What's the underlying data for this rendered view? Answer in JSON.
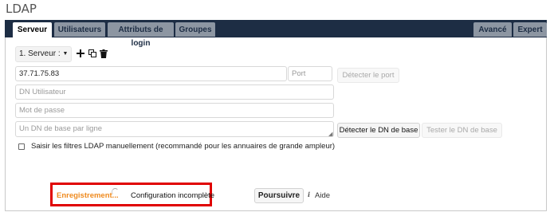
{
  "page": {
    "title": "LDAP"
  },
  "tabs": {
    "serveur": "Serveur",
    "utilisateurs": "Utilisateurs",
    "attributs": "Attributs de login",
    "groupes": "Groupes",
    "avance": "Avancé",
    "expert": "Expert"
  },
  "server": {
    "select_label": "1. Serveur :",
    "host_value": "37.71.75.83",
    "port_placeholder": "Port",
    "detect_port_label": "Détecter le port",
    "dn_user_placeholder": "DN Utilisateur",
    "password_placeholder": "Mot de passe",
    "base_dn_placeholder": "Un DN de base par ligne",
    "detect_base_dn_label": "Détecter le DN de base",
    "test_base_dn_label": "Tester le DN de base",
    "manual_filters_label": "Saisir les filtres LDAP manuellement (recommandé pour les annuaires de grande ampleur)"
  },
  "footer": {
    "saving_label": "Enregistrement...",
    "status_label": "Configuration incomplète",
    "continue_label": "Poursuivre",
    "help_label": "Aide"
  },
  "colors": {
    "tabbar": "#1d2d44",
    "saving": "#ef8a1e",
    "highlight": "#e00000"
  },
  "icons": [
    "add-icon",
    "copy-icon",
    "trash-icon",
    "info-icon",
    "spinner-icon"
  ]
}
